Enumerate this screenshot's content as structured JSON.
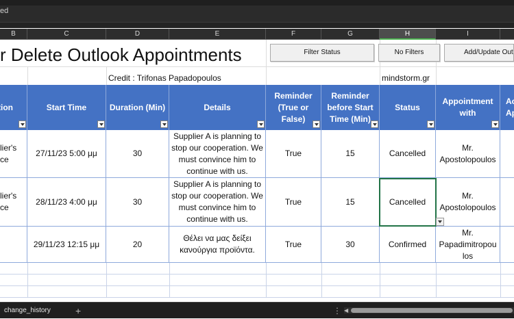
{
  "message_bar": {
    "text": "ed"
  },
  "columns": [
    "B",
    "C",
    "D",
    "E",
    "F",
    "G",
    "H",
    "I"
  ],
  "title": "r Delete Outlook Appointments",
  "buttons": {
    "filter_status": "Filter Status",
    "no_filters": "No Filters",
    "add_update": "Add/Update Outl"
  },
  "credit": "Credit : Trifonas Papadopoulos",
  "site": "mindstorm.gr",
  "headers": [
    "tion",
    "Start Time",
    "Duration (Min)",
    "Details",
    "Reminder (True or False)",
    "Reminder before Start Time (Min)",
    "Status",
    "Appointment with",
    "Ac Ap"
  ],
  "header_last_line1": "Ac",
  "header_last_line2": "Ap",
  "rows": [
    {
      "a": "lier's\nce",
      "start": "27/11/23 5:00 μμ",
      "duration": "30",
      "details": "Supplier A is planning to stop our cooperation. We must convince him to continue with us.",
      "reminder": "True",
      "before": "15",
      "status": "Cancelled",
      "with": "Mr. Apostolopoulos"
    },
    {
      "a": "lier's\nce",
      "start": "28/11/23 4:00 μμ",
      "duration": "30",
      "details": "Supplier A is planning to stop our cooperation. We must convince him to continue with us.",
      "reminder": "True",
      "before": "15",
      "status": "Cancelled",
      "with": "Mr. Apostolopoulos"
    },
    {
      "a": "",
      "start": "29/11/23 12:15 μμ",
      "duration": "20",
      "details": "Θέλει να μας δείξει κανούργια προϊόντα.",
      "reminder": "True",
      "before": "30",
      "status": "Confirmed",
      "with": "Mr. Papadimitropou los"
    }
  ],
  "row0_a_line1": "lier's",
  "row0_a_line2": "ce",
  "row1_a_line1": "lier's",
  "row1_a_line2": "ce",
  "sheet_tab": "change_history",
  "add_sheet": "+",
  "more": "⋮",
  "colors": {
    "header_blue": "#4472c4",
    "selection_green": "#217346"
  }
}
